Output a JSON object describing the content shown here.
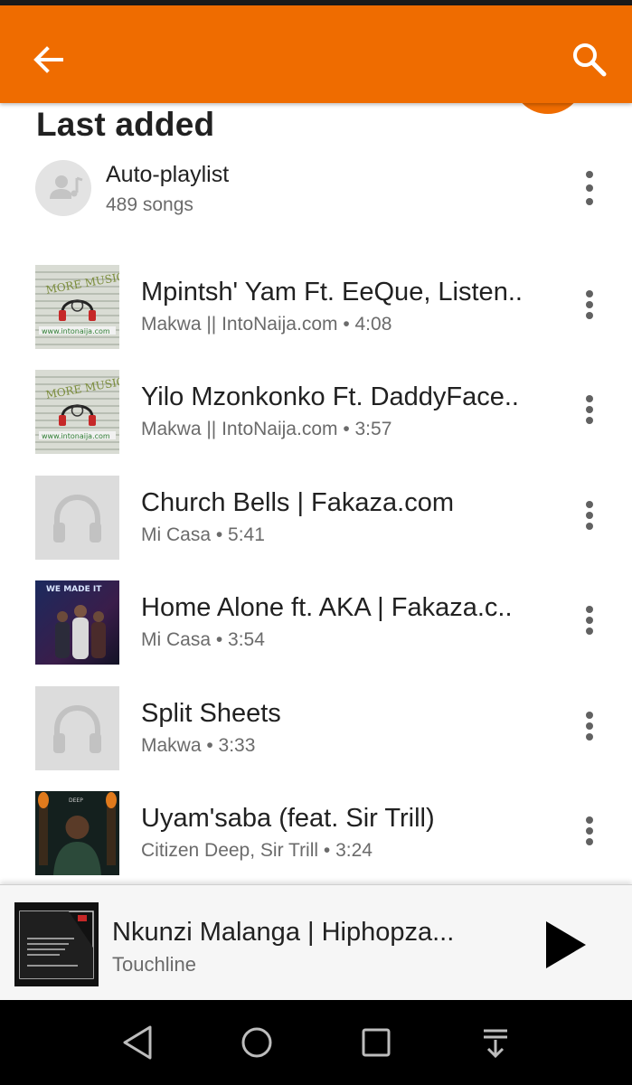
{
  "appbar": {
    "back_icon": "arrow-back-icon",
    "search_icon": "search-icon",
    "color": "#ef6c00"
  },
  "playlist": {
    "title": "Last added",
    "type_label": "Auto-playlist",
    "count_label": "489 songs",
    "avatar_icon": "person-music-icon",
    "menu_icon": "more-vert-icon"
  },
  "songs": [
    {
      "title": "Mpintsh' Yam Ft. EeQue, Listen..",
      "subtitle": "Makwa || IntoNaija.com • 4:08",
      "art": "more-music-intonaija-art"
    },
    {
      "title": "Yilo Mzonkonko Ft. DaddyFace..",
      "subtitle": "Makwa || IntoNaija.com • 3:57",
      "art": "more-music-intonaija-art"
    },
    {
      "title": "Church Bells | Fakaza.com",
      "subtitle": "Mi Casa • 5:41",
      "art": "headphones-placeholder-icon"
    },
    {
      "title": "Home Alone ft. AKA | Fakaza.c..",
      "subtitle": "Mi Casa • 3:54",
      "art": "we-made-it-album-art"
    },
    {
      "title": "Split Sheets",
      "subtitle": "Makwa • 3:33",
      "art": "headphones-placeholder-icon"
    },
    {
      "title": "Uyam'saba (feat. Sir Trill)",
      "subtitle": "Citizen Deep, Sir Trill • 3:24",
      "art": "citizen-deep-album-art"
    }
  ],
  "now_playing": {
    "title": "Nkunzi Malanga | Hiphopza...",
    "artist": "Touchline",
    "play_icon": "play-icon"
  },
  "navbar": {
    "icons": [
      "back-triangle-icon",
      "home-circle-icon",
      "recents-square-icon",
      "notification-pulldown-icon"
    ]
  }
}
